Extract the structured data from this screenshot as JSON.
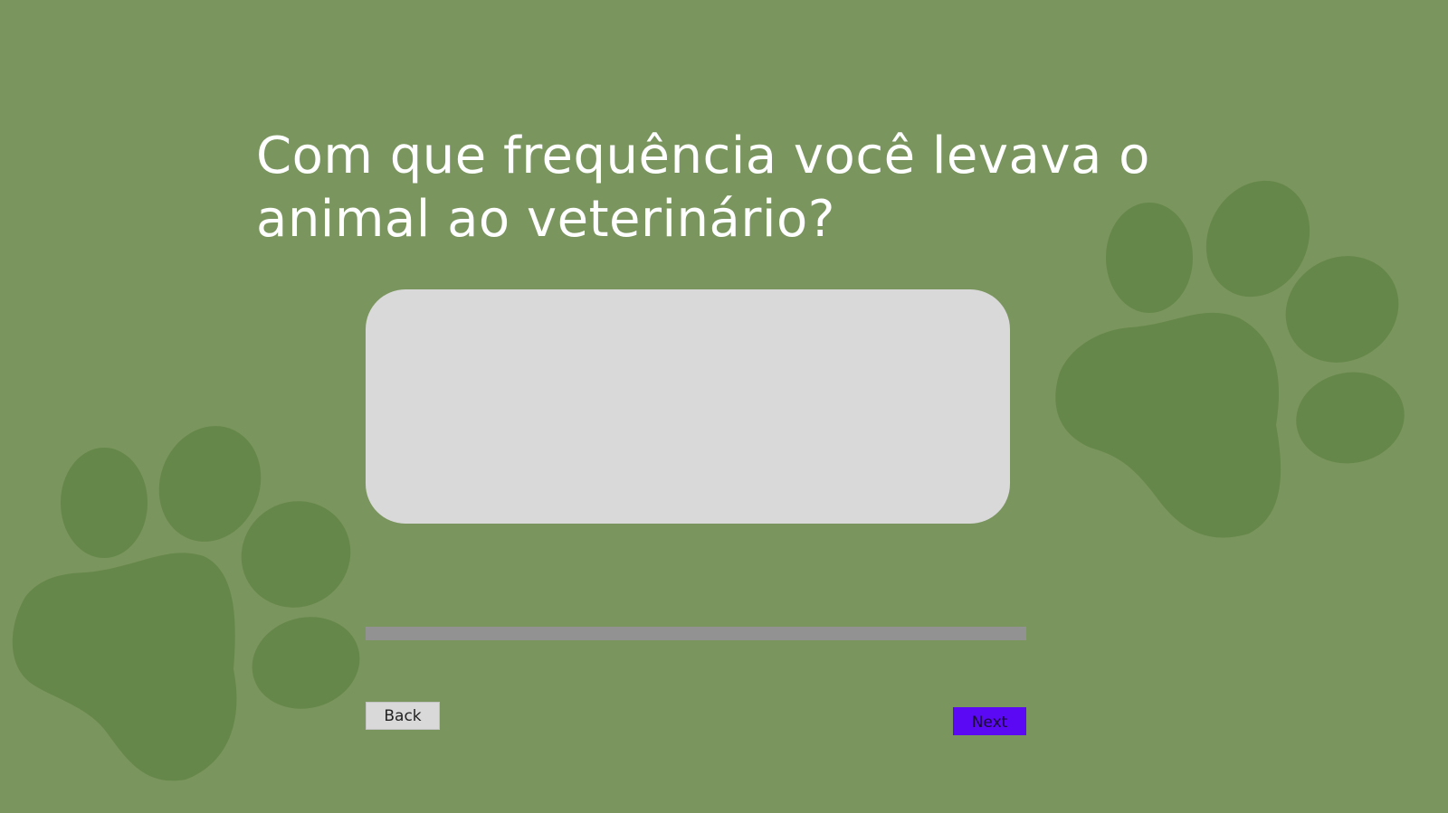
{
  "question": {
    "title": "Com que frequência você levava o animal ao veterinário?"
  },
  "answer": {
    "value": "",
    "placeholder": ""
  },
  "progress": {
    "fraction": 1.0
  },
  "navigation": {
    "back_label": "Back",
    "next_label": "Next"
  },
  "decorations": {
    "left_icon": "paw-print-icon",
    "right_icon": "paw-print-icon"
  },
  "colors": {
    "background": "#7a955e",
    "paw": "#658749",
    "answer_box": "#d9d9d9",
    "progress": "#929292",
    "next_button": "#5b08f5",
    "back_button": "#d9d9d9"
  }
}
